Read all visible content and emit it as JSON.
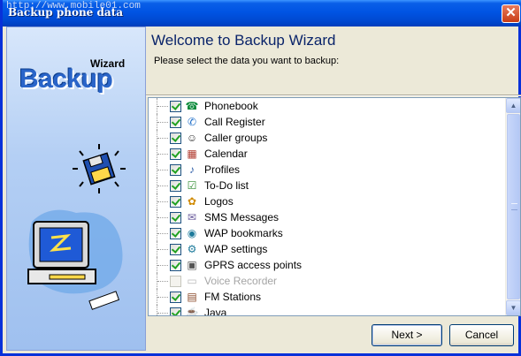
{
  "window": {
    "title": "Backup phone data",
    "watermark": "http://www.mobile01.com",
    "close_label": "✕"
  },
  "side": {
    "wizard_text": "Wizard",
    "backup_text": "Backup"
  },
  "header": {
    "title": "Welcome to Backup Wizard",
    "subtitle": "Please select the data you want to backup:"
  },
  "items": [
    {
      "label": "Phonebook",
      "checked": true,
      "icon": "phonebook-icon",
      "glyph": "☎",
      "color": "#0a8a3a"
    },
    {
      "label": "Call Register",
      "checked": true,
      "icon": "call-register-icon",
      "glyph": "✆",
      "color": "#1f6fc9"
    },
    {
      "label": "Caller groups",
      "checked": true,
      "icon": "caller-groups-icon",
      "glyph": "☺",
      "color": "#333"
    },
    {
      "label": "Calendar",
      "checked": true,
      "icon": "calendar-icon",
      "glyph": "▦",
      "color": "#b03a2e"
    },
    {
      "label": "Profiles",
      "checked": true,
      "icon": "profiles-icon",
      "glyph": "♪",
      "color": "#2f5ea8"
    },
    {
      "label": "To-Do list",
      "checked": true,
      "icon": "todo-list-icon",
      "glyph": "☑",
      "color": "#2d8a2d"
    },
    {
      "label": "Logos",
      "checked": true,
      "icon": "logos-icon",
      "glyph": "✿",
      "color": "#d08a00"
    },
    {
      "label": "SMS Messages",
      "checked": true,
      "icon": "sms-messages-icon",
      "glyph": "✉",
      "color": "#6a5b9c"
    },
    {
      "label": "WAP bookmarks",
      "checked": true,
      "icon": "wap-bookmarks-icon",
      "glyph": "◉",
      "color": "#1d7a9b"
    },
    {
      "label": "WAP settings",
      "checked": true,
      "icon": "wap-settings-icon",
      "glyph": "⚙",
      "color": "#1d7a9b"
    },
    {
      "label": "GPRS access points",
      "checked": true,
      "icon": "gprs-icon",
      "glyph": "▣",
      "color": "#555"
    },
    {
      "label": "Voice Recorder",
      "checked": false,
      "icon": "voice-recorder-icon",
      "glyph": "▭",
      "color": "#b9b9b9",
      "disabled": true
    },
    {
      "label": "FM Stations",
      "checked": true,
      "icon": "fm-stations-icon",
      "glyph": "▤",
      "color": "#8a4a2a"
    },
    {
      "label": "Java",
      "checked": true,
      "icon": "java-icon",
      "glyph": "☕",
      "color": "#b03a2e"
    }
  ],
  "buttons": {
    "next": "Next >",
    "cancel": "Cancel"
  },
  "colors": {
    "title_bar": "#0054e3",
    "header_title": "#0a246a",
    "check": "#21a121"
  }
}
